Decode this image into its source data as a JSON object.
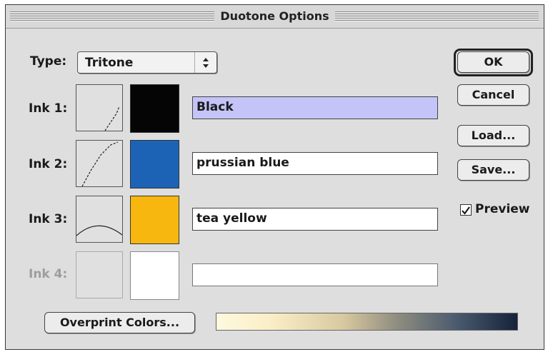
{
  "dialog": {
    "title": "Duotone Options"
  },
  "type": {
    "label": "Type:",
    "value": "Tritone"
  },
  "inks": [
    {
      "label": "Ink 1:",
      "name": "Black",
      "swatch_color": "#050505",
      "selected": true,
      "enabled": true
    },
    {
      "label": "Ink 2:",
      "name": "prussian blue",
      "swatch_color": "#1d63b5",
      "selected": false,
      "enabled": true
    },
    {
      "label": "Ink 3:",
      "name": "tea yellow",
      "swatch_color": "#f7b70f",
      "selected": false,
      "enabled": true
    },
    {
      "label": "Ink 4:",
      "name": "",
      "swatch_color": "#ffffff",
      "selected": false,
      "enabled": false
    }
  ],
  "buttons": {
    "ok": "OK",
    "cancel": "Cancel",
    "load": "Load...",
    "save": "Save...",
    "overprint": "Overprint Colors..."
  },
  "preview": {
    "label": "Preview",
    "checked": true
  },
  "colors": {
    "selection": "#c4c4f8",
    "gradient": [
      "#fdf9e0",
      "#d8c9a0",
      "#8f8d80",
      "#4a5a6e",
      "#15233a"
    ]
  }
}
